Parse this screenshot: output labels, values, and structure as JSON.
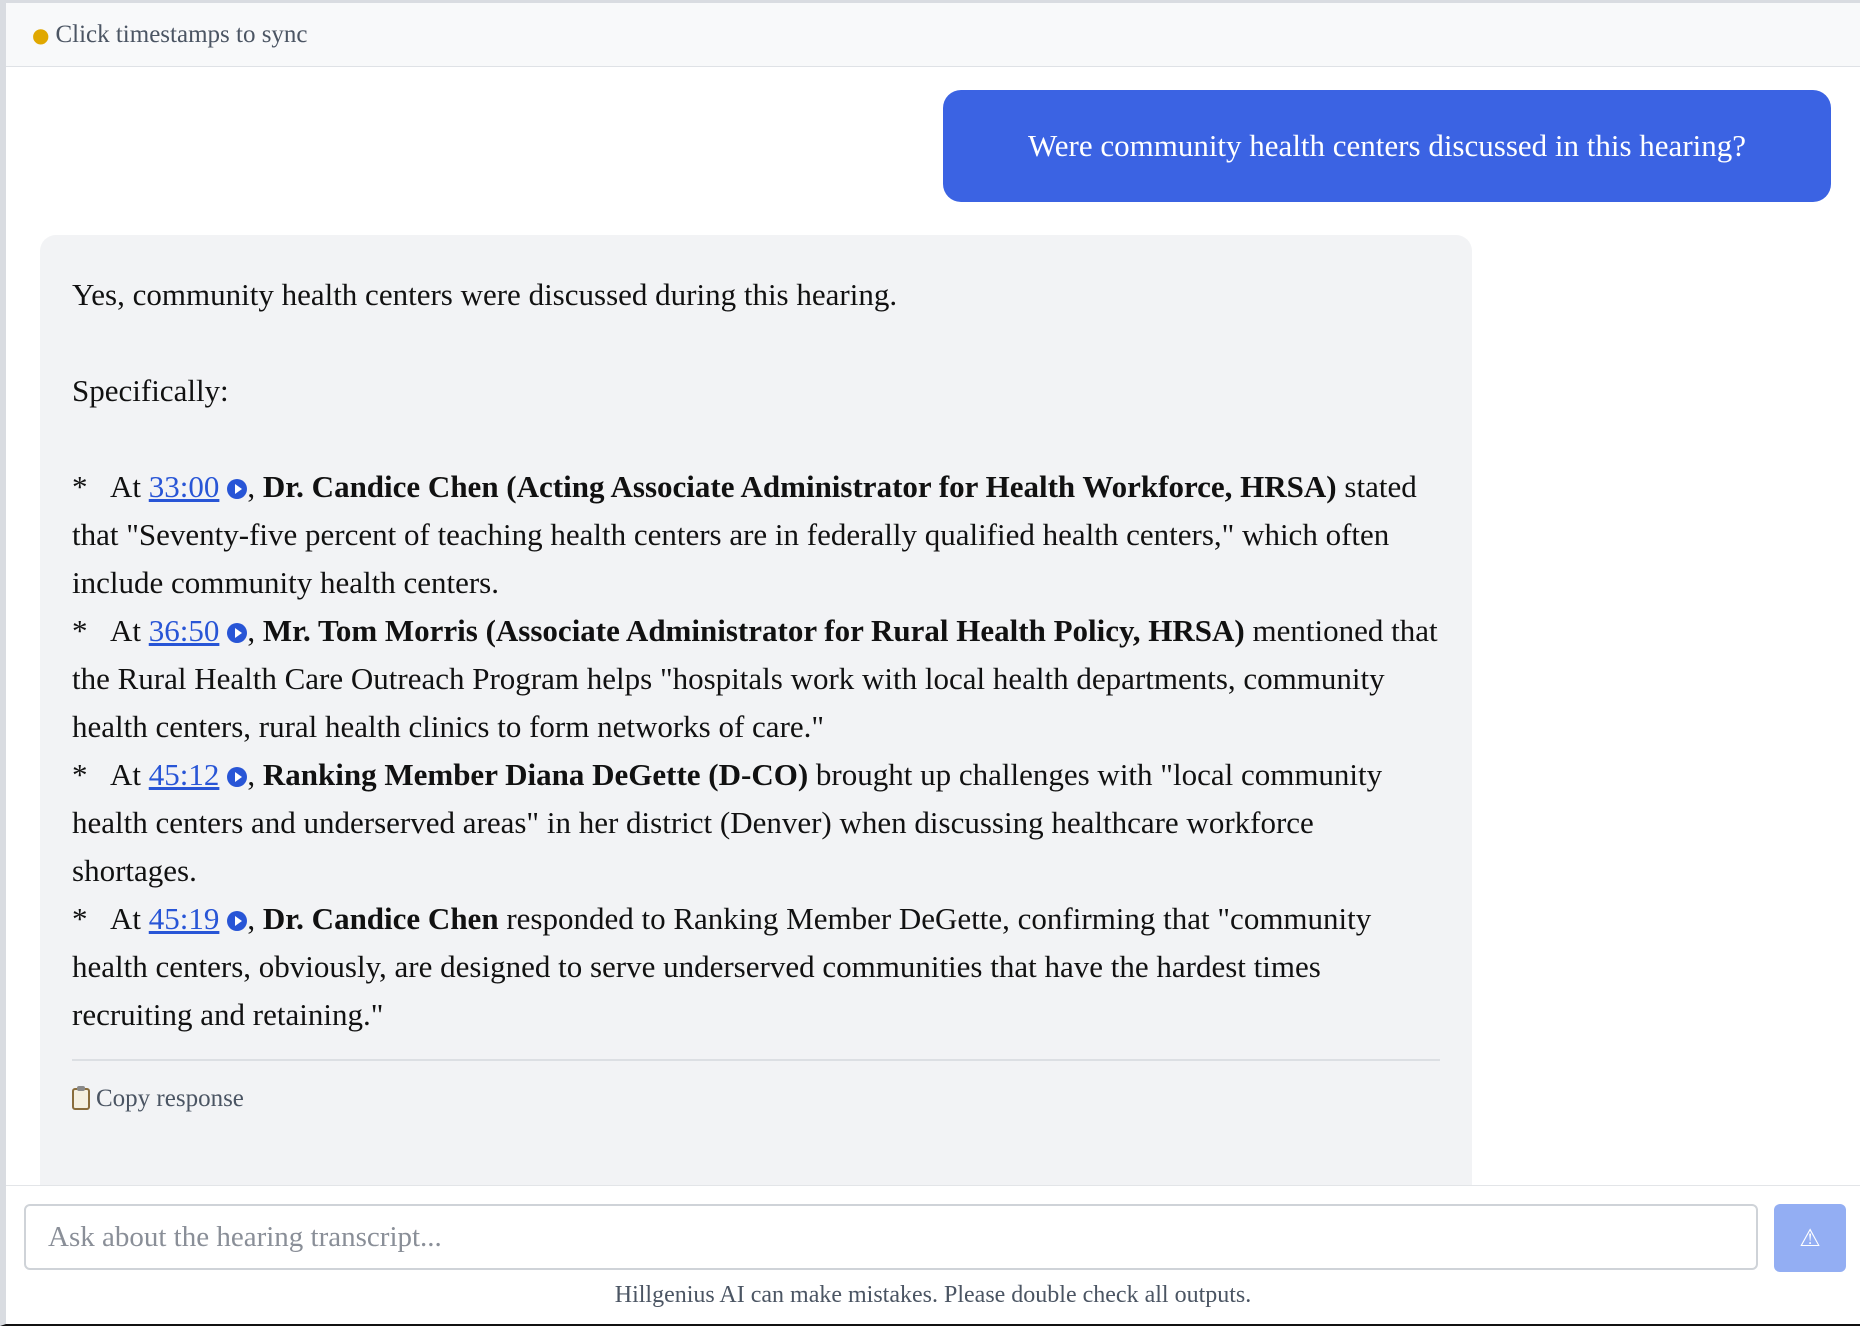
{
  "tip_bar": {
    "icon": "lightbulb-icon",
    "text": "Click timestamps to sync"
  },
  "user_message": {
    "text": "Were community health centers discussed in this hearing?"
  },
  "ai_message": {
    "intro": "Yes, community health centers were discussed during this hearing.",
    "lead": "Specifically:",
    "bullet_char": "*",
    "at_word": "At",
    "items": [
      {
        "timestamp": "33:00",
        "speaker": "Dr. Candice Chen (Acting Associate Administrator for Health Workforce, HRSA)",
        "text": "stated that \"Seventy-five percent of teaching health centers are in federally qualified health centers,\" which often include community health centers."
      },
      {
        "timestamp": "36:50",
        "speaker": "Mr. Tom Morris (Associate Administrator for Rural Health Policy, HRSA)",
        "text": "mentioned that the Rural Health Care Outreach Program helps \"hospitals work with local health departments, community health centers, rural health clinics to form networks of care.\""
      },
      {
        "timestamp": "45:12",
        "speaker": "Ranking Member Diana DeGette (D-CO)",
        "text": "brought up challenges with \"local community health centers and underserved areas\" in her district (Denver) when discussing healthcare workforce shortages."
      },
      {
        "timestamp": "45:19",
        "speaker": "Dr. Candice Chen",
        "text": "responded to Ranking Member DeGette, confirming that \"community health centers, obviously, are designed to serve underserved communities that have the hardest times recruiting and retaining.\""
      }
    ],
    "copy_label": "Copy response",
    "copy_icon": "clipboard-icon"
  },
  "input": {
    "placeholder": "Ask about the hearing transcript...",
    "value": "",
    "send_icon": "warning-icon",
    "send_glyph": "⚠"
  },
  "footer": {
    "disclaimer": "Hillgenius AI can make mistakes. Please double check all outputs."
  },
  "colors": {
    "user_bubble": "#3b63e3",
    "link": "#2855d6",
    "ai_bubble": "#f2f3f5",
    "send_button": "#93aef3"
  }
}
